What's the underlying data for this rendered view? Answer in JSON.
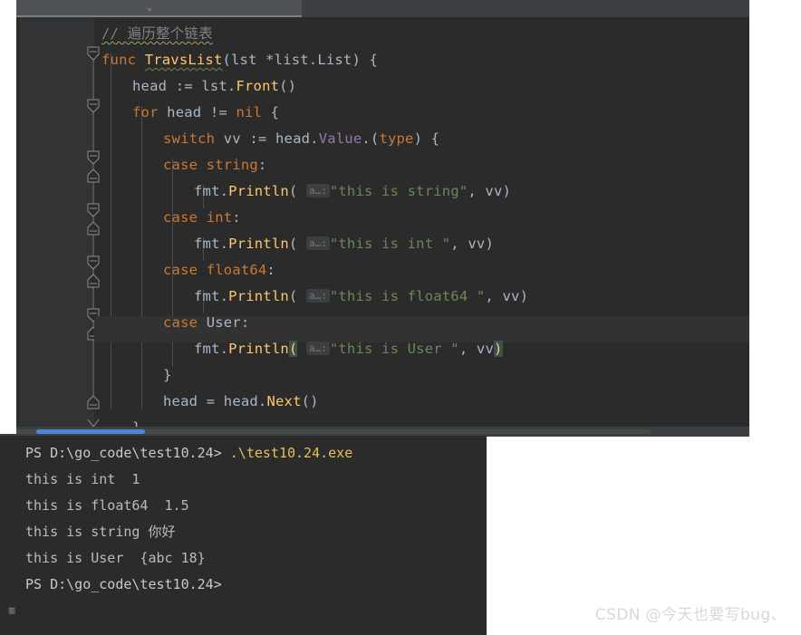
{
  "window": {
    "tab_glyph": "⌄"
  },
  "editor": {
    "language": "Go",
    "caret_line_index": 11,
    "colors": {
      "background": "#2b2b2b",
      "gutter": "#313335",
      "caret_line": "#323232",
      "keyword": "#cc7832",
      "function": "#ffc66d",
      "string": "#6a8759",
      "comment": "#808080",
      "identifier": "#a9b7c6",
      "field": "#9876aa",
      "scrollbar_thumb": "#4b87d6"
    },
    "inlay_hint_label": "a…:",
    "lines": [
      {
        "indent": 1,
        "text": "// 遍历整个链表"
      },
      {
        "indent": 1,
        "text": "func TravsList(lst *list.List) {"
      },
      {
        "indent": 2,
        "text": "head := lst.Front()"
      },
      {
        "indent": 2,
        "text": "for head != nil {"
      },
      {
        "indent": 3,
        "text": "switch vv := head.Value.(type) {"
      },
      {
        "indent": 3,
        "text": "case string:"
      },
      {
        "indent": 4,
        "text": "fmt.Println( a…: \"this is string\", vv)"
      },
      {
        "indent": 3,
        "text": "case int:"
      },
      {
        "indent": 4,
        "text": "fmt.Println( a…: \"this is int \", vv)"
      },
      {
        "indent": 3,
        "text": "case float64:"
      },
      {
        "indent": 4,
        "text": "fmt.Println( a…: \"this is float64 \", vv)"
      },
      {
        "indent": 3,
        "text": "case User:"
      },
      {
        "indent": 4,
        "text": "fmt.Println( a…: \"this is User \", vv)"
      },
      {
        "indent": 3,
        "text": "}"
      },
      {
        "indent": 3,
        "text": "head = head.Next()"
      },
      {
        "indent": 2,
        "text": "}"
      }
    ],
    "tokens": {
      "comment_text": "// 遍历整个链表",
      "kw_func": "func",
      "fn_name": "TravsList",
      "sig_rest": "(lst *list.List) {",
      "head": "head",
      "assign_define": ":=",
      "lst": "lst",
      "dot": ".",
      "front": "Front",
      "parens": "()",
      "kw_for": "for",
      "neq": "!=",
      "kw_nil": "nil",
      "open_brace": "{",
      "kw_switch": "switch",
      "vv": "vv",
      "value": "Value",
      "kw_type": "type",
      "kw_case": "case",
      "type_string": "string",
      "type_int": "int",
      "type_float64": "float64",
      "type_user": "User",
      "fmt": "fmt",
      "println": "Println",
      "str_string": "\"this is string\"",
      "str_int": "\"this is int \"",
      "str_float64": "\"this is float64 \"",
      "str_user": "\"this is User \"",
      "comma_vv": ", vv",
      "close_paren": ")",
      "close_brace": "}",
      "assign_eq": "=",
      "next": "Next"
    }
  },
  "terminal": {
    "icon": "▥",
    "lines": [
      {
        "type": "prompt",
        "prompt": "PS D:\\go_code\\test10.24>",
        "command": " .\\test10.24.exe"
      },
      {
        "type": "output",
        "text": "this is int  1"
      },
      {
        "type": "output",
        "text": "this is float64  1.5"
      },
      {
        "type": "output",
        "text": "this is string 你好"
      },
      {
        "type": "output",
        "text": "this is User  {abc 18}"
      },
      {
        "type": "prompt",
        "prompt": "PS D:\\go_code\\test10.24>",
        "command": ""
      }
    ]
  },
  "watermark": {
    "text": "CSDN @今天也要写bug、"
  }
}
